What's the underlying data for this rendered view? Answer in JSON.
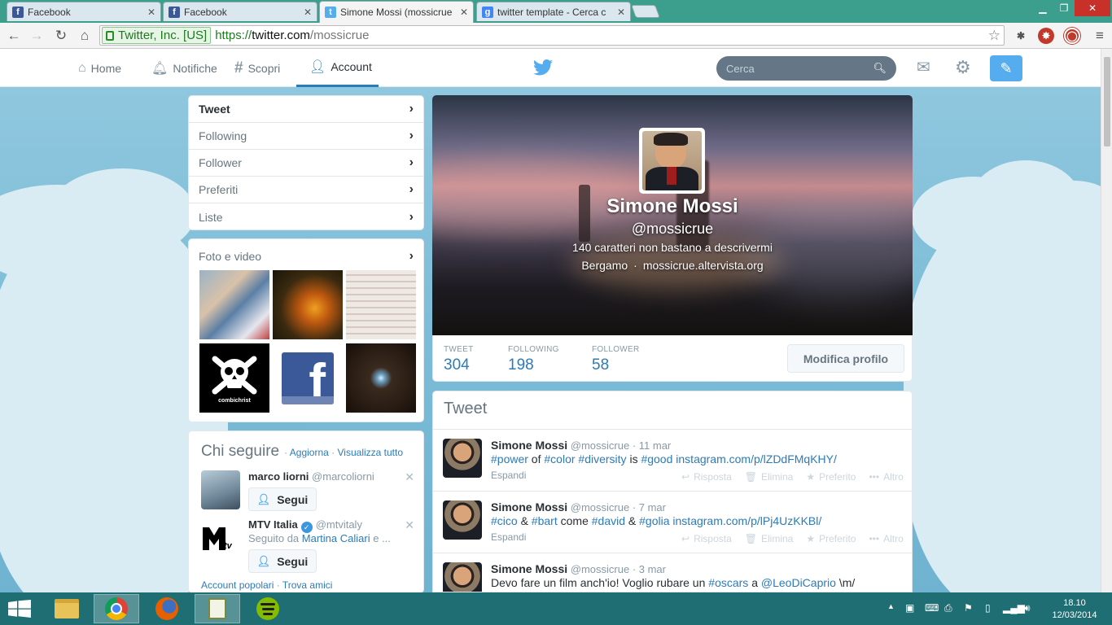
{
  "browser": {
    "tabs": [
      {
        "title": "Facebook",
        "icon": "facebook-icon",
        "active": false
      },
      {
        "title": "Facebook",
        "icon": "facebook-icon",
        "active": false
      },
      {
        "title": "Simone Mossi (mossicrue",
        "icon": "twitter-icon",
        "active": true
      },
      {
        "title": "twitter template - Cerca c",
        "icon": "google-icon",
        "active": false
      }
    ],
    "ev_badge": "Twitter, Inc. [US]",
    "url_scheme": "https://",
    "url_host": "twitter.com",
    "url_path": "/mossicrue"
  },
  "twitter": {
    "nav": {
      "home": "Home",
      "notifications": "Notifiche",
      "discover": "Scopri",
      "account": "Account"
    },
    "search_placeholder": "Cerca",
    "sidebar": {
      "items": [
        {
          "label": "Tweet"
        },
        {
          "label": "Following"
        },
        {
          "label": "Follower"
        },
        {
          "label": "Preferiti"
        },
        {
          "label": "Liste"
        }
      ]
    },
    "media": {
      "title": "Foto e video",
      "tile_texts": {
        "combichrist": "combichrist"
      }
    },
    "who_to_follow": {
      "title": "Chi seguire",
      "refresh": "Aggiorna",
      "view_all": "Visualizza tutto",
      "separator": "·",
      "users": [
        {
          "name": "marco liorni",
          "handle": "@marcoliorni",
          "follow": "Segui"
        },
        {
          "name": "MTV Italia",
          "handle": "@mtvitaly",
          "followed_prefix": "Seguito da",
          "followed_by": "Martina Caliari",
          "followed_suffix": "e ...",
          "follow": "Segui"
        }
      ],
      "footer_popular": "Account popolari",
      "footer_find": "Trova amici"
    },
    "profile": {
      "name": "Simone Mossi",
      "handle": "@mossicrue",
      "bio": "140 caratteri non bastano a descrivermi",
      "location": "Bergamo",
      "location_sep": "·",
      "website": "mossicrue.altervista.org",
      "stats": [
        {
          "label": "TWEET",
          "value": "304"
        },
        {
          "label": "FOLLOWING",
          "value": "198"
        },
        {
          "label": "FOLLOWER",
          "value": "58"
        }
      ],
      "edit_button": "Modifica profilo"
    },
    "stream": {
      "title": "Tweet",
      "tweets": [
        {
          "name": "Simone Mossi",
          "handle": "@mossicrue",
          "date": "11 mar",
          "parts": [
            {
              "t": "#power",
              "h": true
            },
            {
              "t": " of ",
              "h": false
            },
            {
              "t": "#color",
              "h": true
            },
            {
              "t": " ",
              "h": false
            },
            {
              "t": "#diversity",
              "h": true
            },
            {
              "t": " is ",
              "h": false
            },
            {
              "t": "#good",
              "h": true
            },
            {
              "t": " ",
              "h": false
            },
            {
              "t": "instagram.com/p/lZDdFMqKHY/",
              "h": true
            }
          ],
          "expand": "Espandi"
        },
        {
          "name": "Simone Mossi",
          "handle": "@mossicrue",
          "date": "7 mar",
          "parts": [
            {
              "t": "#cico",
              "h": true
            },
            {
              "t": " & ",
              "h": false
            },
            {
              "t": "#bart",
              "h": true
            },
            {
              "t": " come ",
              "h": false
            },
            {
              "t": "#david",
              "h": true
            },
            {
              "t": " & ",
              "h": false
            },
            {
              "t": "#golia",
              "h": true
            },
            {
              "t": " ",
              "h": false
            },
            {
              "t": "instagram.com/p/lPj4UzKKBl/",
              "h": true
            }
          ],
          "expand": "Espandi"
        },
        {
          "name": "Simone Mossi",
          "handle": "@mossicrue",
          "date": "3 mar",
          "parts": [
            {
              "t": "Devo fare un film anch'io! Voglio rubare un ",
              "h": false
            },
            {
              "t": "#oscars",
              "h": true
            },
            {
              "t": " a ",
              "h": false
            },
            {
              "t": "@LeoDiCaprio",
              "h": true
            },
            {
              "t": " \\m/",
              "h": false
            }
          ],
          "expand": ""
        }
      ],
      "actions": {
        "reply": "Risposta",
        "delete": "Elimina",
        "favorite": "Preferito",
        "more": "Altro"
      }
    }
  },
  "taskbar": {
    "time": "18.10",
    "date": "12/03/2014"
  },
  "colors": {
    "twitter_blue": "#55acee",
    "link_blue": "#2b7bb9",
    "tabstrip": "#3c9f8e",
    "taskbar": "#1e6e73"
  }
}
